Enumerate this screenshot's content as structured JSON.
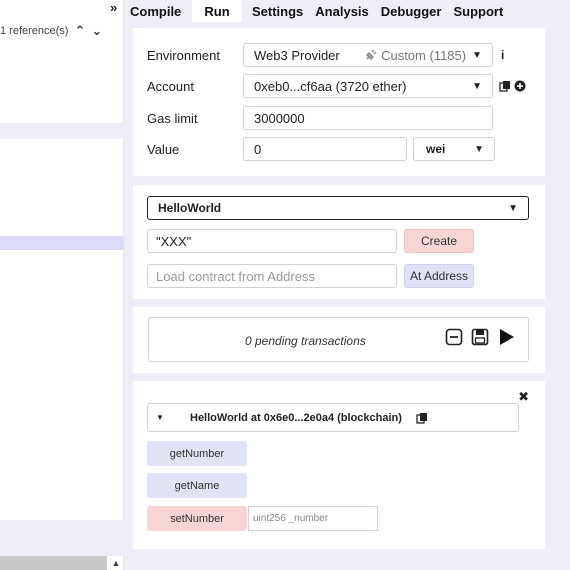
{
  "left": {
    "reference_text": "1 reference(s)",
    "up_arrow": "⌃",
    "down_arrow": "⌄",
    "scroll_arrow": "▲"
  },
  "tabs": {
    "collapse_glyph": "»",
    "items": [
      "Compile",
      "Run",
      "Settings",
      "Analysis",
      "Debugger",
      "Support"
    ],
    "active": "Run"
  },
  "settings": {
    "environment_label": "Environment",
    "environment_value": "Web3 Provider",
    "environment_custom": "Custom (1185)",
    "account_label": "Account",
    "account_value": "0xeb0...cf6aa (3720 ether)",
    "gas_limit_label": "Gas limit",
    "gas_limit_value": "3000000",
    "value_label": "Value",
    "value_value": "0",
    "value_unit": "wei"
  },
  "contract": {
    "selected": "HelloWorld",
    "constructor_arg": "\"XXX\"",
    "create_label": "Create",
    "load_placeholder": "Load contract from Address",
    "at_address_label": "At Address"
  },
  "pending": {
    "text": "0 pending transactions"
  },
  "instance": {
    "title": "HelloWorld at 0x6e0...2e0a4 (blockchain)",
    "functions": [
      {
        "name": "getNumber",
        "kind": "view"
      },
      {
        "name": "getName",
        "kind": "view"
      },
      {
        "name": "setNumber",
        "kind": "transact",
        "param_placeholder": "uint256 _number"
      }
    ]
  },
  "colors": {
    "panel_bg": "#eeeef7",
    "create_bg": "#f8d5d5",
    "call_bg": "#e0e2f6"
  }
}
